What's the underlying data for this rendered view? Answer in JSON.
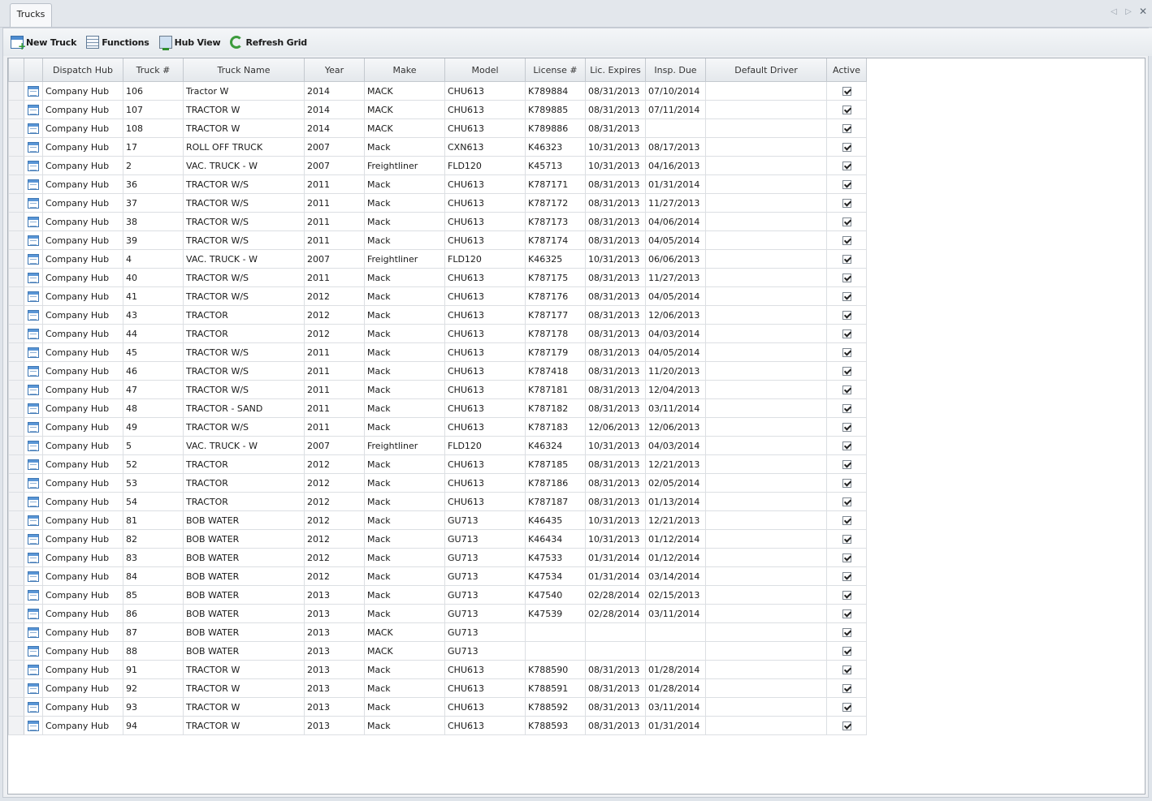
{
  "tabs": [
    {
      "label": "Trucks"
    }
  ],
  "toolbar": {
    "new_truck": "New Truck",
    "functions": "Functions",
    "hub_view": "Hub View",
    "refresh_grid": "Refresh Grid"
  },
  "columns": [
    "Dispatch Hub",
    "Truck #",
    "Truck Name",
    "Year",
    "Make",
    "Model",
    "License #",
    "Lic. Expires",
    "Insp. Due",
    "Default Driver",
    "Active"
  ],
  "rows": [
    {
      "hub": "Company Hub",
      "truck": "106",
      "name": "Tractor W",
      "year": "2014",
      "make": "MACK",
      "model": "CHU613",
      "license": "K789884",
      "lic_expires": "08/31/2013",
      "insp_due": "07/10/2014",
      "driver": "",
      "active": true
    },
    {
      "hub": "Company Hub",
      "truck": "107",
      "name": "TRACTOR W",
      "year": "2014",
      "make": "MACK",
      "model": "CHU613",
      "license": "K789885",
      "lic_expires": "08/31/2013",
      "insp_due": "07/11/2014",
      "driver": "",
      "active": true
    },
    {
      "hub": "Company Hub",
      "truck": "108",
      "name": "TRACTOR W",
      "year": "2014",
      "make": "MACK",
      "model": "CHU613",
      "license": "K789886",
      "lic_expires": "08/31/2013",
      "insp_due": "",
      "driver": "",
      "active": true
    },
    {
      "hub": "Company Hub",
      "truck": "17",
      "name": "ROLL OFF TRUCK",
      "year": "2007",
      "make": "Mack",
      "model": "CXN613",
      "license": "K46323",
      "lic_expires": "10/31/2013",
      "insp_due": "08/17/2013",
      "driver": "",
      "active": true
    },
    {
      "hub": "Company Hub",
      "truck": "2",
      "name": "VAC. TRUCK - W",
      "year": "2007",
      "make": "Freightliner",
      "model": "FLD120",
      "license": "K45713",
      "lic_expires": "10/31/2013",
      "insp_due": "04/16/2013",
      "driver": "",
      "active": true
    },
    {
      "hub": "Company Hub",
      "truck": "36",
      "name": "TRACTOR W/S",
      "year": "2011",
      "make": "Mack",
      "model": "CHU613",
      "license": "K787171",
      "lic_expires": "08/31/2013",
      "insp_due": "01/31/2014",
      "driver": "",
      "active": true
    },
    {
      "hub": "Company Hub",
      "truck": "37",
      "name": "TRACTOR W/S",
      "year": "2011",
      "make": "Mack",
      "model": "CHU613",
      "license": "K787172",
      "lic_expires": "08/31/2013",
      "insp_due": "11/27/2013",
      "driver": "",
      "active": true
    },
    {
      "hub": "Company Hub",
      "truck": "38",
      "name": "TRACTOR W/S",
      "year": "2011",
      "make": "Mack",
      "model": "CHU613",
      "license": "K787173",
      "lic_expires": "08/31/2013",
      "insp_due": "04/06/2014",
      "driver": "",
      "active": true
    },
    {
      "hub": "Company Hub",
      "truck": "39",
      "name": "TRACTOR W/S",
      "year": "2011",
      "make": "Mack",
      "model": "CHU613",
      "license": "K787174",
      "lic_expires": "08/31/2013",
      "insp_due": "04/05/2014",
      "driver": "",
      "active": true
    },
    {
      "hub": "Company Hub",
      "truck": "4",
      "name": "VAC. TRUCK - W",
      "year": "2007",
      "make": "Freightliner",
      "model": "FLD120",
      "license": "K46325",
      "lic_expires": "10/31/2013",
      "insp_due": "06/06/2013",
      "driver": "",
      "active": true
    },
    {
      "hub": "Company Hub",
      "truck": "40",
      "name": "TRACTOR W/S",
      "year": "2011",
      "make": "Mack",
      "model": "CHU613",
      "license": "K787175",
      "lic_expires": "08/31/2013",
      "insp_due": "11/27/2013",
      "driver": "",
      "active": true
    },
    {
      "hub": "Company Hub",
      "truck": "41",
      "name": "TRACTOR W/S",
      "year": "2012",
      "make": "Mack",
      "model": "CHU613",
      "license": "K787176",
      "lic_expires": "08/31/2013",
      "insp_due": "04/05/2014",
      "driver": "",
      "active": true
    },
    {
      "hub": "Company Hub",
      "truck": "43",
      "name": "TRACTOR",
      "year": "2012",
      "make": "Mack",
      "model": "CHU613",
      "license": "K787177",
      "lic_expires": "08/31/2013",
      "insp_due": "12/06/2013",
      "driver": "",
      "active": true
    },
    {
      "hub": "Company Hub",
      "truck": "44",
      "name": "TRACTOR",
      "year": "2012",
      "make": "Mack",
      "model": "CHU613",
      "license": "K787178",
      "lic_expires": "08/31/2013",
      "insp_due": "04/03/2014",
      "driver": "",
      "active": true
    },
    {
      "hub": "Company Hub",
      "truck": "45",
      "name": "TRACTOR W/S",
      "year": "2011",
      "make": "Mack",
      "model": "CHU613",
      "license": "K787179",
      "lic_expires": "08/31/2013",
      "insp_due": "04/05/2014",
      "driver": "",
      "active": true
    },
    {
      "hub": "Company Hub",
      "truck": "46",
      "name": "TRACTOR W/S",
      "year": "2011",
      "make": "Mack",
      "model": "CHU613",
      "license": "K787418",
      "lic_expires": "08/31/2013",
      "insp_due": "11/20/2013",
      "driver": "",
      "active": true
    },
    {
      "hub": "Company Hub",
      "truck": "47",
      "name": "TRACTOR W/S",
      "year": "2011",
      "make": "Mack",
      "model": "CHU613",
      "license": "K787181",
      "lic_expires": "08/31/2013",
      "insp_due": "12/04/2013",
      "driver": "",
      "active": true
    },
    {
      "hub": "Company Hub",
      "truck": "48",
      "name": "TRACTOR - SAND",
      "year": "2011",
      "make": "Mack",
      "model": "CHU613",
      "license": "K787182",
      "lic_expires": "08/31/2013",
      "insp_due": "03/11/2014",
      "driver": "",
      "active": true
    },
    {
      "hub": "Company Hub",
      "truck": "49",
      "name": "TRACTOR W/S",
      "year": "2011",
      "make": "Mack",
      "model": "CHU613",
      "license": "K787183",
      "lic_expires": "12/06/2013",
      "insp_due": "12/06/2013",
      "driver": "",
      "active": true
    },
    {
      "hub": "Company Hub",
      "truck": "5",
      "name": "VAC. TRUCK - W",
      "year": "2007",
      "make": "Freightliner",
      "model": "FLD120",
      "license": "K46324",
      "lic_expires": "10/31/2013",
      "insp_due": "04/03/2014",
      "driver": "",
      "active": true
    },
    {
      "hub": "Company Hub",
      "truck": "52",
      "name": "TRACTOR",
      "year": "2012",
      "make": "Mack",
      "model": "CHU613",
      "license": "K787185",
      "lic_expires": "08/31/2013",
      "insp_due": "12/21/2013",
      "driver": "",
      "active": true
    },
    {
      "hub": "Company Hub",
      "truck": "53",
      "name": "TRACTOR",
      "year": "2012",
      "make": "Mack",
      "model": "CHU613",
      "license": "K787186",
      "lic_expires": "08/31/2013",
      "insp_due": "02/05/2014",
      "driver": "",
      "active": true
    },
    {
      "hub": "Company Hub",
      "truck": "54",
      "name": "TRACTOR",
      "year": "2012",
      "make": "Mack",
      "model": "CHU613",
      "license": "K787187",
      "lic_expires": "08/31/2013",
      "insp_due": "01/13/2014",
      "driver": "",
      "active": true
    },
    {
      "hub": "Company Hub",
      "truck": "81",
      "name": "BOB WATER",
      "year": "2012",
      "make": "Mack",
      "model": "GU713",
      "license": "K46435",
      "lic_expires": "10/31/2013",
      "insp_due": "12/21/2013",
      "driver": "",
      "active": true
    },
    {
      "hub": "Company Hub",
      "truck": "82",
      "name": "BOB WATER",
      "year": "2012",
      "make": "Mack",
      "model": "GU713",
      "license": "K46434",
      "lic_expires": "10/31/2013",
      "insp_due": "01/12/2014",
      "driver": "",
      "active": true
    },
    {
      "hub": "Company Hub",
      "truck": "83",
      "name": "BOB WATER",
      "year": "2012",
      "make": "Mack",
      "model": "GU713",
      "license": "K47533",
      "lic_expires": "01/31/2014",
      "insp_due": "01/12/2014",
      "driver": "",
      "active": true
    },
    {
      "hub": "Company Hub",
      "truck": "84",
      "name": "BOB WATER",
      "year": "2012",
      "make": "Mack",
      "model": "GU713",
      "license": "K47534",
      "lic_expires": "01/31/2014",
      "insp_due": "03/14/2014",
      "driver": "",
      "active": true
    },
    {
      "hub": "Company Hub",
      "truck": "85",
      "name": "BOB WATER",
      "year": "2013",
      "make": "Mack",
      "model": "GU713",
      "license": "K47540",
      "lic_expires": "02/28/2014",
      "insp_due": "02/15/2013",
      "driver": "",
      "active": true
    },
    {
      "hub": "Company Hub",
      "truck": "86",
      "name": "BOB WATER",
      "year": "2013",
      "make": "Mack",
      "model": "GU713",
      "license": "K47539",
      "lic_expires": "02/28/2014",
      "insp_due": "03/11/2014",
      "driver": "",
      "active": true
    },
    {
      "hub": "Company Hub",
      "truck": "87",
      "name": "BOB WATER",
      "year": "2013",
      "make": "MACK",
      "model": "GU713",
      "license": "",
      "lic_expires": "",
      "insp_due": "",
      "driver": "",
      "active": true
    },
    {
      "hub": "Company Hub",
      "truck": "88",
      "name": "BOB WATER",
      "year": "2013",
      "make": "MACK",
      "model": "GU713",
      "license": "",
      "lic_expires": "",
      "insp_due": "",
      "driver": "",
      "active": true
    },
    {
      "hub": "Company Hub",
      "truck": "91",
      "name": "TRACTOR W",
      "year": "2013",
      "make": "Mack",
      "model": "CHU613",
      "license": "K788590",
      "lic_expires": "08/31/2013",
      "insp_due": "01/28/2014",
      "driver": "",
      "active": true
    },
    {
      "hub": "Company Hub",
      "truck": "92",
      "name": "TRACTOR W",
      "year": "2013",
      "make": "Mack",
      "model": "CHU613",
      "license": "K788591",
      "lic_expires": "08/31/2013",
      "insp_due": "01/28/2014",
      "driver": "",
      "active": true
    },
    {
      "hub": "Company Hub",
      "truck": "93",
      "name": "TRACTOR W",
      "year": "2013",
      "make": "Mack",
      "model": "CHU613",
      "license": "K788592",
      "lic_expires": "08/31/2013",
      "insp_due": "03/11/2014",
      "driver": "",
      "active": true
    },
    {
      "hub": "Company Hub",
      "truck": "94",
      "name": "TRACTOR W",
      "year": "2013",
      "make": "Mack",
      "model": "CHU613",
      "license": "K788593",
      "lic_expires": "08/31/2013",
      "insp_due": "01/31/2014",
      "driver": "",
      "active": true
    }
  ]
}
